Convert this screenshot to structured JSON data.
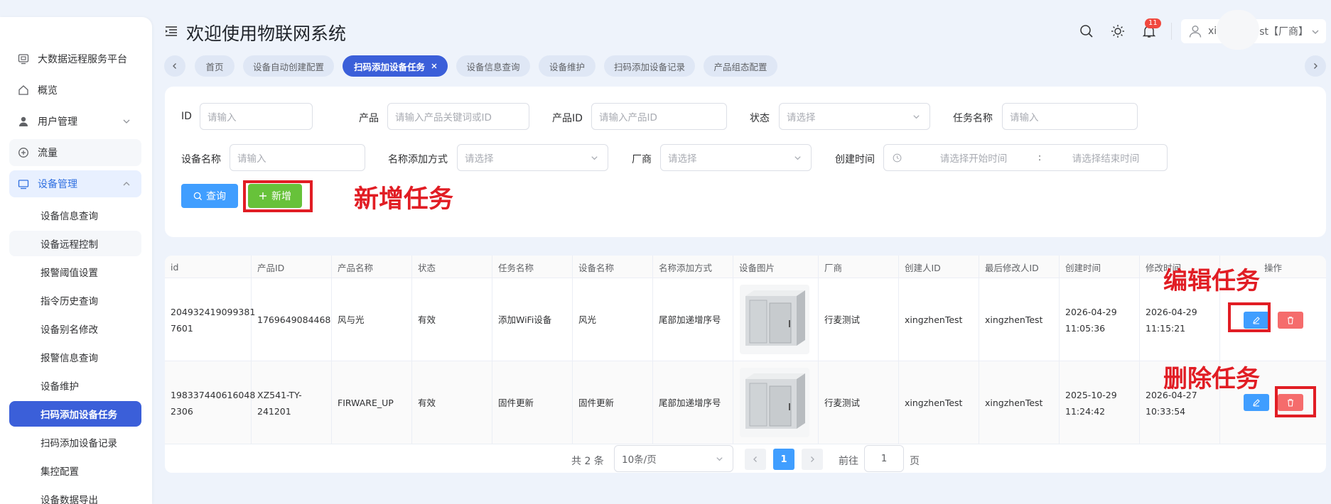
{
  "header": {
    "title": "欢迎使用物联网系统",
    "notif_count": "11",
    "user_prefix": "xi",
    "user_suffix": "st【厂商】"
  },
  "sidebar": {
    "platform": "大数据远程服务平台",
    "overview": "概览",
    "user_mgmt": "用户管理",
    "traffic": "流量",
    "device_mgmt": "设备管理",
    "subs": [
      "设备信息查询",
      "设备远程控制",
      "报警阈值设置",
      "指令历史查询",
      "设备别名修改",
      "报警信息查询",
      "设备维护",
      "扫码添加设备任务",
      "扫码添加设备记录",
      "集控配置",
      "设备数据导出"
    ]
  },
  "tabs": [
    "首页",
    "设备自动创建配置",
    "扫码添加设备任务",
    "设备信息查询",
    "设备维护",
    "扫码添加设备记录",
    "产品组态配置"
  ],
  "filters": {
    "id_label": "ID",
    "id_ph": "请输入",
    "product_label": "产品",
    "product_ph": "请输入产品关键词或ID",
    "product_id_label": "产品ID",
    "product_id_ph": "请输入产品ID",
    "status_label": "状态",
    "status_ph": "请选择",
    "task_name_label": "任务名称",
    "task_name_ph": "请输入",
    "device_name_label": "设备名称",
    "device_name_ph": "请输入",
    "naming_label": "名称添加方式",
    "naming_ph": "请选择",
    "vendor_label": "厂商",
    "vendor_ph": "请选择",
    "created_label": "创建时间",
    "start_ph": "请选择开始时间",
    "sep": ":",
    "end_ph": "请选择结束时间"
  },
  "buttons": {
    "query": "查询",
    "add": "新增"
  },
  "annotations": {
    "add": "新增任务",
    "edit": "编辑任务",
    "delete": "删除任务"
  },
  "table": {
    "headers": [
      "id",
      "产品ID",
      "产品名称",
      "状态",
      "任务名称",
      "设备名称",
      "名称添加方式",
      "设备图片",
      "厂商",
      "创建人ID",
      "最后修改人ID",
      "创建时间",
      "修改时间",
      "操作"
    ],
    "rows": [
      {
        "id": [
          "204932419099381",
          "7601"
        ],
        "product_id": [
          "1769649084468"
        ],
        "product_name": "风与光",
        "status": "有效",
        "task_name": "添加WiFi设备",
        "device_name": "风光",
        "naming": "尾部加递增序号",
        "vendor": "行麦测试",
        "creator": "xingzhenTest",
        "modifier": "xingzhenTest",
        "created": [
          "2026-04-29",
          "11:05:36"
        ],
        "modified": [
          "2026-04-29",
          "11:15:21"
        ]
      },
      {
        "id": [
          "198337440616048",
          "2306"
        ],
        "product_id": [
          "XZ541-TY-",
          "241201"
        ],
        "product_name": "FIRWARE_UP",
        "status": "有效",
        "task_name": "固件更新",
        "device_name": "固件更新",
        "naming": "尾部加递增序号",
        "vendor": "行麦测试",
        "creator": "xingzhenTest",
        "modifier": "xingzhenTest",
        "created": [
          "2025-10-29",
          "11:24:42"
        ],
        "modified": [
          "2026-04-27",
          "10:33:54"
        ]
      }
    ]
  },
  "pagination": {
    "total": "共 2 条",
    "page_size": "10条/页",
    "current": "1",
    "goto_prefix": "前往",
    "goto_value": "1",
    "goto_suffix": "页"
  },
  "colors": {
    "primary": "#3b5fd9",
    "accent_blue": "#409eff",
    "success": "#67c23a",
    "danger": "#f56c6c",
    "annotation": "#e11d24"
  }
}
